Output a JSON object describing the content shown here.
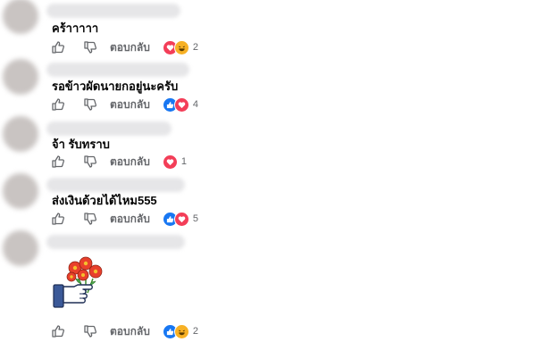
{
  "reply_label": "ตอบกลับ",
  "comments": [
    {
      "text": "คร้าาาาา",
      "reactions": [
        "love",
        "haha"
      ],
      "count": "2"
    },
    {
      "text": "รอข้าวผัดนายกอยู่นะครับ",
      "reactions": [
        "like",
        "love"
      ],
      "count": "4"
    },
    {
      "text": "จ้า รับทราบ",
      "reactions": [
        "love"
      ],
      "count": "1"
    },
    {
      "text": "ส่งเงินด้วยได้ไหม555",
      "reactions": [
        "like",
        "love"
      ],
      "count": "5"
    },
    {
      "text": "",
      "sticker": "flower-bouquet-thumb-sticker",
      "reactions": [
        "like",
        "haha"
      ],
      "count": "2"
    }
  ],
  "colors": {
    "like": "#1877f2",
    "love": "#f33e58",
    "haha": "#f7b125",
    "muted": "#65676b"
  }
}
